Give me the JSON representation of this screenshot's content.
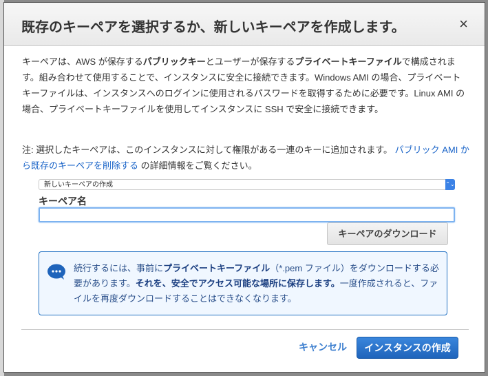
{
  "dialog": {
    "title": "既存のキーペアを選択するか、新しいキーペアを作成します。",
    "close_label": "×",
    "description": {
      "p1": "キーペアは、AWS が保存する",
      "b1": "パブリックキー",
      "p2": "とユーザーが保存する",
      "b2": "プライベートキーファイル",
      "p3": "で構成されます。組み合わせて使用することで、インスタンスに安全に接続できます。Windows AMI の場合、プライベートキーファイルは、インスタンスへのログインに使用されるパスワードを取得するために必要です。Linux AMI の場合、プライベートキーファイルを使用してインスタンスに SSH で安全に接続できます。"
    },
    "note": {
      "text": "注: 選択したキーペアは、このインスタンスに対して権限がある一連のキーに追加されます。",
      "link": "パブリック AMI から既存のキーペアを削除する",
      "suffix": "の詳細情報をご覧ください。"
    },
    "select": {
      "value": "新しいキーペアの作成",
      "arrows": "⌃⌄"
    },
    "key_name_label": "キーペア名",
    "key_name_value": "",
    "download_button": "キーペアのダウンロード",
    "info": {
      "icon": "speech-bubble-icon",
      "p1": "続行するには、事前に",
      "b1": "プライベートキーファイル",
      "p2": "（*.pem ファイル）をダウンロードする必要があります。",
      "b2": "それを、安全でアクセス可能な場所に保存します。",
      "p3": "一度作成されると、ファイルを再度ダウンロードすることはできなくなります。"
    },
    "cancel_button": "キャンセル",
    "create_button": "インスタンスの作成"
  },
  "colors": {
    "accent": "#1f64bb",
    "link": "#1a64c8",
    "info_bg": "#f0f7ff"
  }
}
